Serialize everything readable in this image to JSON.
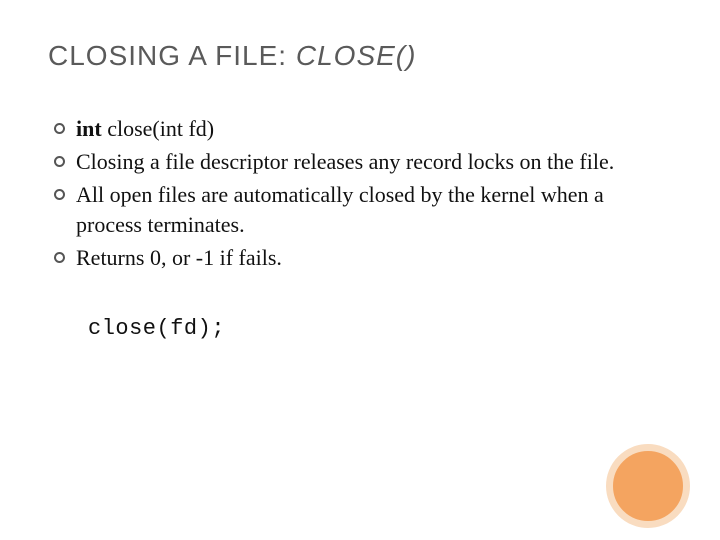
{
  "title": {
    "main": "CLOSING A FILE: ",
    "emph": "CLOSE()"
  },
  "bullets": [
    {
      "bold": "int",
      "rest": " close(int fd)"
    },
    {
      "bold": "",
      "rest": "Closing a file descriptor releases any record locks on the file."
    },
    {
      "bold": "",
      "rest": "All open files are automatically closed by the kernel when a process terminates."
    },
    {
      "bold": "",
      "rest": "Returns 0, or -1 if fails."
    }
  ],
  "code": "close(fd);"
}
